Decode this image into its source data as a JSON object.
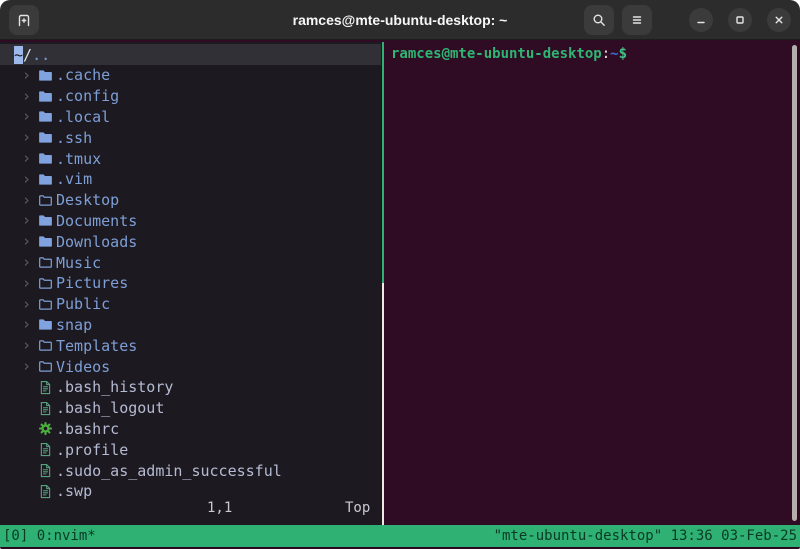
{
  "titlebar": {
    "title": "ramces@mte-ubuntu-desktop: ~"
  },
  "icons": {
    "chevron_glyph": "›",
    "names": [
      "new-tab-icon",
      "search-icon",
      "hamburger-menu-icon",
      "minimize-icon",
      "maximize-icon",
      "close-icon",
      "folder-icon",
      "folder-outline-icon",
      "file-icon",
      "gear-icon",
      "chevron-right-icon"
    ]
  },
  "tree": {
    "root": {
      "cursor_char": "~",
      "slash": "/",
      "dots": ".."
    },
    "items": [
      {
        "label": ".cache",
        "type": "folder-filled"
      },
      {
        "label": ".config",
        "type": "folder-filled"
      },
      {
        "label": ".local",
        "type": "folder-filled"
      },
      {
        "label": ".ssh",
        "type": "folder-filled"
      },
      {
        "label": ".tmux",
        "type": "folder-filled"
      },
      {
        "label": ".vim",
        "type": "folder-filled"
      },
      {
        "label": "Desktop",
        "type": "folder-outline"
      },
      {
        "label": "Documents",
        "type": "folder-filled"
      },
      {
        "label": "Downloads",
        "type": "folder-filled"
      },
      {
        "label": "Music",
        "type": "folder-outline"
      },
      {
        "label": "Pictures",
        "type": "folder-outline"
      },
      {
        "label": "Public",
        "type": "folder-outline"
      },
      {
        "label": "snap",
        "type": "folder-filled"
      },
      {
        "label": "Templates",
        "type": "folder-outline"
      },
      {
        "label": "Videos",
        "type": "folder-outline"
      },
      {
        "label": ".bash_history",
        "type": "file"
      },
      {
        "label": ".bash_logout",
        "type": "file"
      },
      {
        "label": ".bashrc",
        "type": "gear"
      },
      {
        "label": ".profile",
        "type": "file"
      },
      {
        "label": ".sudo_as_admin_successful",
        "type": "file"
      },
      {
        "label": ".swp",
        "type": "file"
      }
    ],
    "ruler": {
      "position": "1,1",
      "scroll": "Top"
    }
  },
  "shell": {
    "user_host": "ramces@mte-ubuntu-desktop",
    "colon": ":",
    "path": "~",
    "prompt_symbol": "$"
  },
  "tmux": {
    "left": "[0] 0:nvim*",
    "right": "\"mte-ubuntu-desktop\" 13:36 03-Feb-25"
  },
  "colors": {
    "titlebar_bg": "#2c2c2c",
    "nvim_bg": "#1d1920",
    "selected_row_bg": "#303036",
    "terminal_bg": "#2f0c24",
    "accent_green": "#2eb173",
    "folder_blue": "#7d9fd6",
    "file_text_gray": "#b4bbd2",
    "gear_green": "#4cae3f",
    "doc_teal": "#56a17e",
    "prompt_blue": "#3a6fd8",
    "scrollbar_gray": "#b3afab"
  }
}
